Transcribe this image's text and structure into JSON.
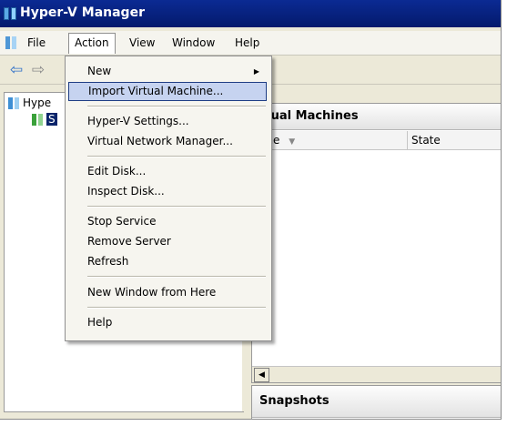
{
  "window": {
    "title": "Hyper-V Manager"
  },
  "menubar": {
    "items": [
      "File",
      "Action",
      "View",
      "Window",
      "Help"
    ]
  },
  "toolbar": {
    "back_glyph": "⇦",
    "forward_glyph": "⇨"
  },
  "tree": {
    "root_label": "Hype",
    "server_label": "S"
  },
  "vm_panel": {
    "title": "rtual Machines",
    "col_name": "ame",
    "col_sort_glyph": "▼",
    "col_state": "State"
  },
  "snapshots_panel": {
    "title": "Snapshots"
  },
  "action_menu": {
    "items": [
      {
        "label": "New",
        "submenu": true
      },
      {
        "label": "Import Virtual Machine...",
        "highlighted": true
      },
      {
        "label": "Hyper-V Settings..."
      },
      {
        "label": "Virtual Network Manager..."
      },
      {
        "label": "Edit Disk..."
      },
      {
        "label": "Inspect Disk..."
      },
      {
        "label": "Stop Service"
      },
      {
        "label": "Remove Server"
      },
      {
        "label": "Refresh"
      },
      {
        "label": "New Window from Here"
      },
      {
        "label": "Help"
      }
    ],
    "submenu_glyph": "▶"
  },
  "colors": {
    "title_bar": "#0b2a93",
    "menu_highlight": "#c6d3f0",
    "selection": "#0a246a"
  }
}
